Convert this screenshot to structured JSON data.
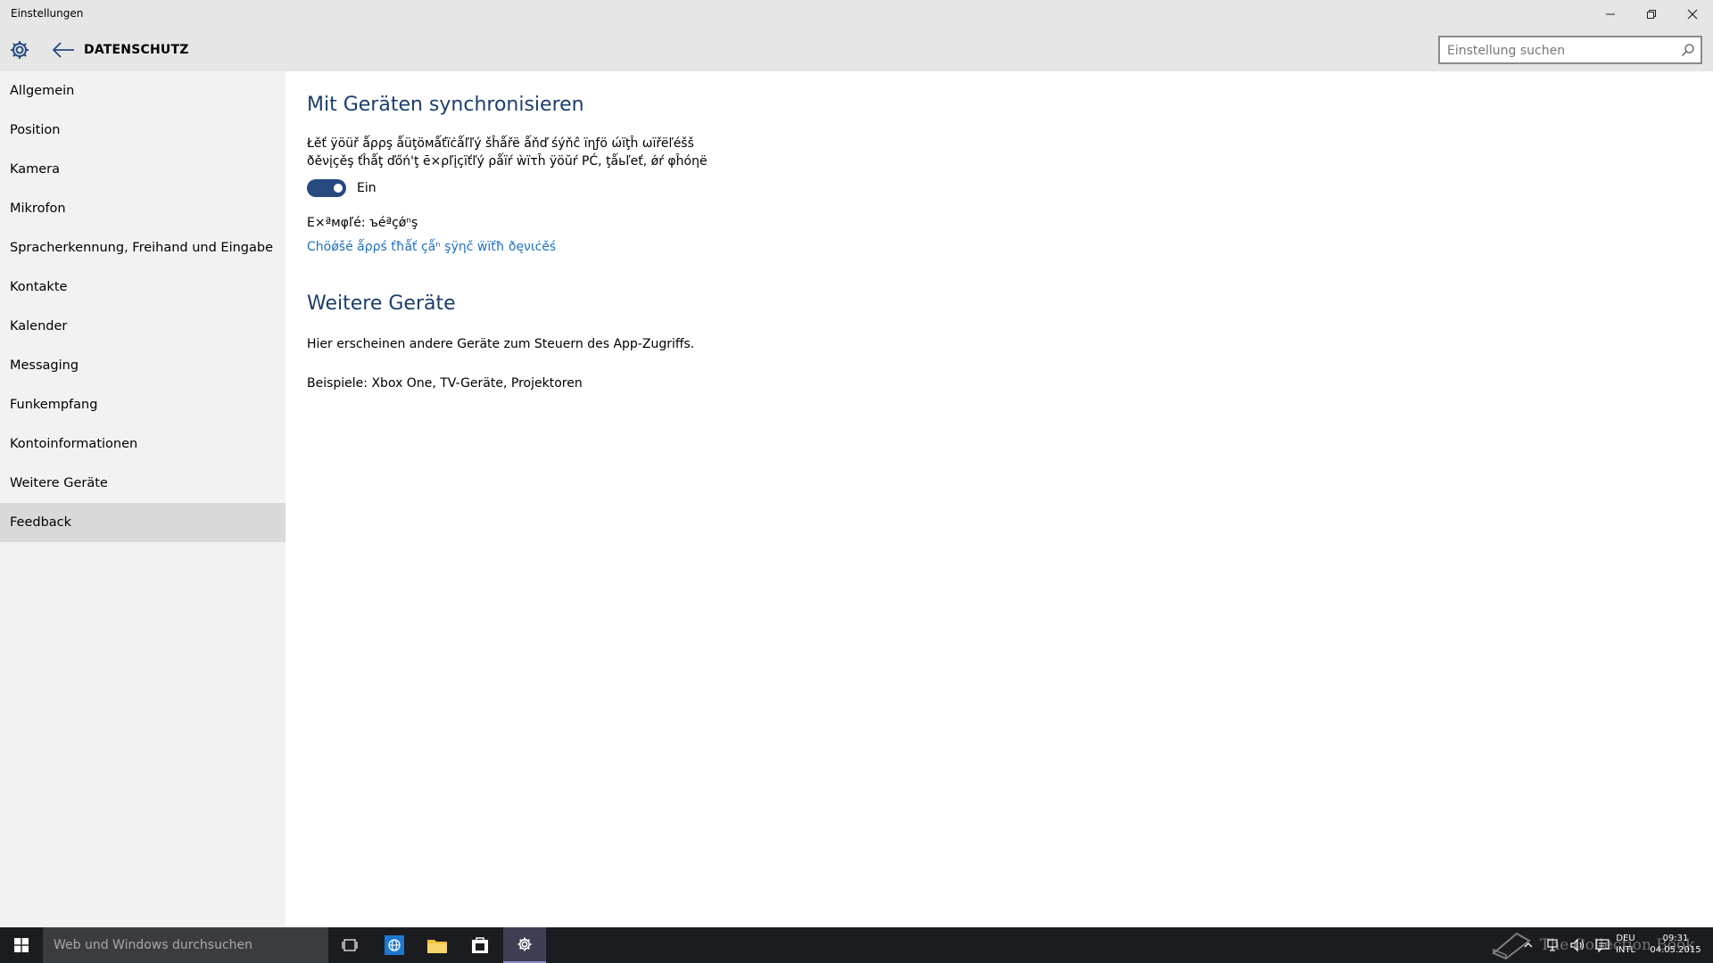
{
  "window": {
    "title": "Einstellungen",
    "minimize_icon": "minimize-icon",
    "maximize_icon": "restore-icon",
    "close_icon": "close-icon"
  },
  "header": {
    "page_title": "DATENSCHUTZ",
    "search_placeholder": "Einstellung suchen"
  },
  "sidebar": {
    "items": [
      {
        "label": "Allgemein"
      },
      {
        "label": "Position"
      },
      {
        "label": "Kamera"
      },
      {
        "label": "Mikrofon"
      },
      {
        "label": "Spracherkennung, Freihand und Eingabe"
      },
      {
        "label": "Kontakte"
      },
      {
        "label": "Kalender"
      },
      {
        "label": "Messaging"
      },
      {
        "label": "Funkempfang"
      },
      {
        "label": "Kontoinformationen"
      },
      {
        "label": "Weitere Geräte"
      },
      {
        "label": "Feedback",
        "selected": true
      }
    ]
  },
  "main": {
    "sync_section": {
      "heading": "Mit Geräten synchronisieren",
      "description_line1": "Łěť ÿöüř ǻρρş ǻüţöмǻťïċǻľľý šĥǻřë ǻňď śýňĉ ïηƒö ώïţĥ ωïřëľéšš",
      "description_line2": "ðěνįçěş ťĥǻţ ďőń'ţ ē×ρľįçïťľý ρǻïŕ ẁïτĥ ÿöŭŕ ΡĆ, ţǻьľеť, ǿŕ φĥóηë",
      "toggle_state": "Ein",
      "example": "E×ªмφľé: ъéªçǿⁿş",
      "link": "Chöǿšé ǻρρś ťħǻť çǻⁿ şÿηč ẅïťħ ðęνιċěś"
    },
    "devices_section": {
      "heading": "Weitere Geräte",
      "description": "Hier erscheinen andere Geräte zum Steuern des App-Zugriffs.",
      "examples": "Beispiele: Xbox One, TV-Geräte, Projektoren"
    }
  },
  "taskbar": {
    "search_placeholder": "Web und Windows durchsuchen",
    "language_top": "DEU",
    "language_bottom": "INTL",
    "time": "09:31",
    "date": "04.05.2015",
    "watermark": "The Collection Book",
    "active_app_color": "#3e3f52"
  },
  "colors": {
    "accent": "#26497f",
    "heading": "#1c3d6e",
    "link": "#1f6fbf",
    "sidebar_bg": "#f2f2f2",
    "selected_item_bg": "#d9d9d9",
    "header_bg": "#e6e6e6"
  }
}
